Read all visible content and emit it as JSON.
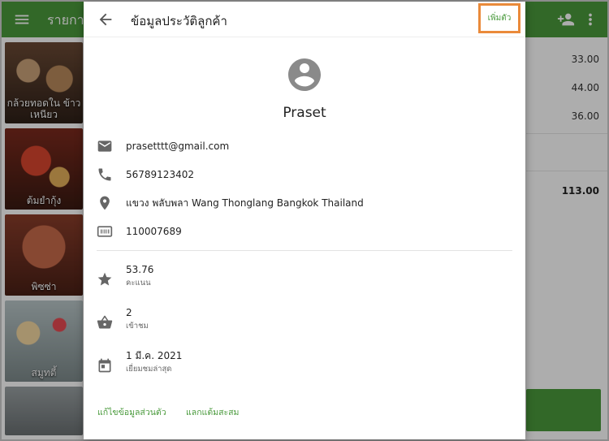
{
  "app": {
    "title": "รายการ",
    "tiles": [
      {
        "label": "กล้วยทอดใน ข้าวเหนียว"
      },
      {
        "label": "ต้มยำกุ้ง"
      },
      {
        "label": "พิซซ่า"
      },
      {
        "label": "สมูทตี้"
      }
    ],
    "amounts": [
      "33.00",
      "44.00",
      "36.00"
    ],
    "total": "113.00"
  },
  "dialog": {
    "title": "ข้อมูลประวัติลูกค้า",
    "add_label": "เพิ่มตัว",
    "customer_name": "Praset",
    "email": "prasetttt@gmail.com",
    "phone": "56789123402",
    "address": "แขวง พลับพลา Wang Thonglang Bangkok Thailand",
    "member_id": "110007689",
    "points": {
      "value": "53.76",
      "label": "คะแนน"
    },
    "visits": {
      "value": "2",
      "label": "เข้าชม"
    },
    "last_visit": {
      "value": "1 มี.ค. 2021",
      "label": "เยี่ยมชมล่าสุด"
    },
    "edit_link": "แก้ไขข้อมูลส่วนตัว",
    "redeem_link": "แลกแต้มสะสม"
  },
  "colors": {
    "accent": "#4a9a3c",
    "highlight": "#ea8a3a"
  }
}
